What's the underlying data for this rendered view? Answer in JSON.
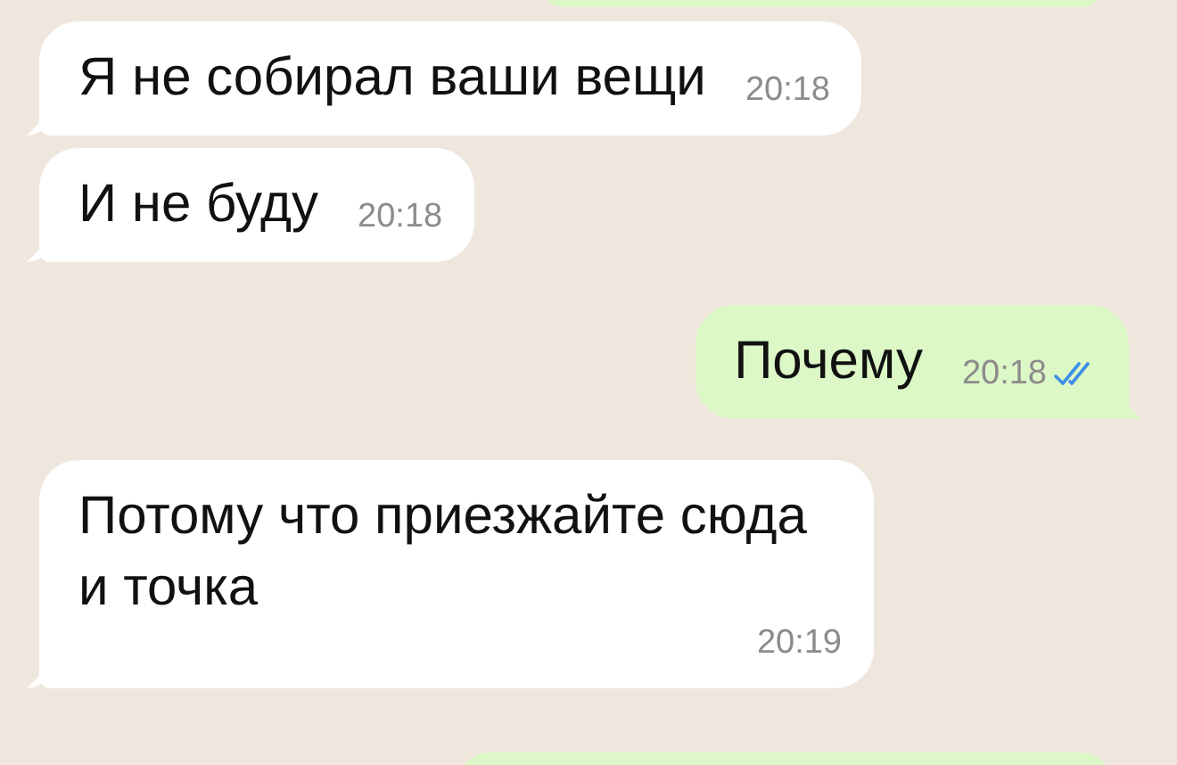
{
  "messages": [
    {
      "kind": "in",
      "text": "Я не собирал ваши вещи",
      "time": "20:18"
    },
    {
      "kind": "in",
      "text": "И не буду",
      "time": "20:18"
    },
    {
      "kind": "out",
      "text": "Почему",
      "time": "20:18",
      "read": true
    },
    {
      "kind": "in",
      "text": "Потому что приезжайте сюда и точка",
      "time": "20:19"
    }
  ]
}
